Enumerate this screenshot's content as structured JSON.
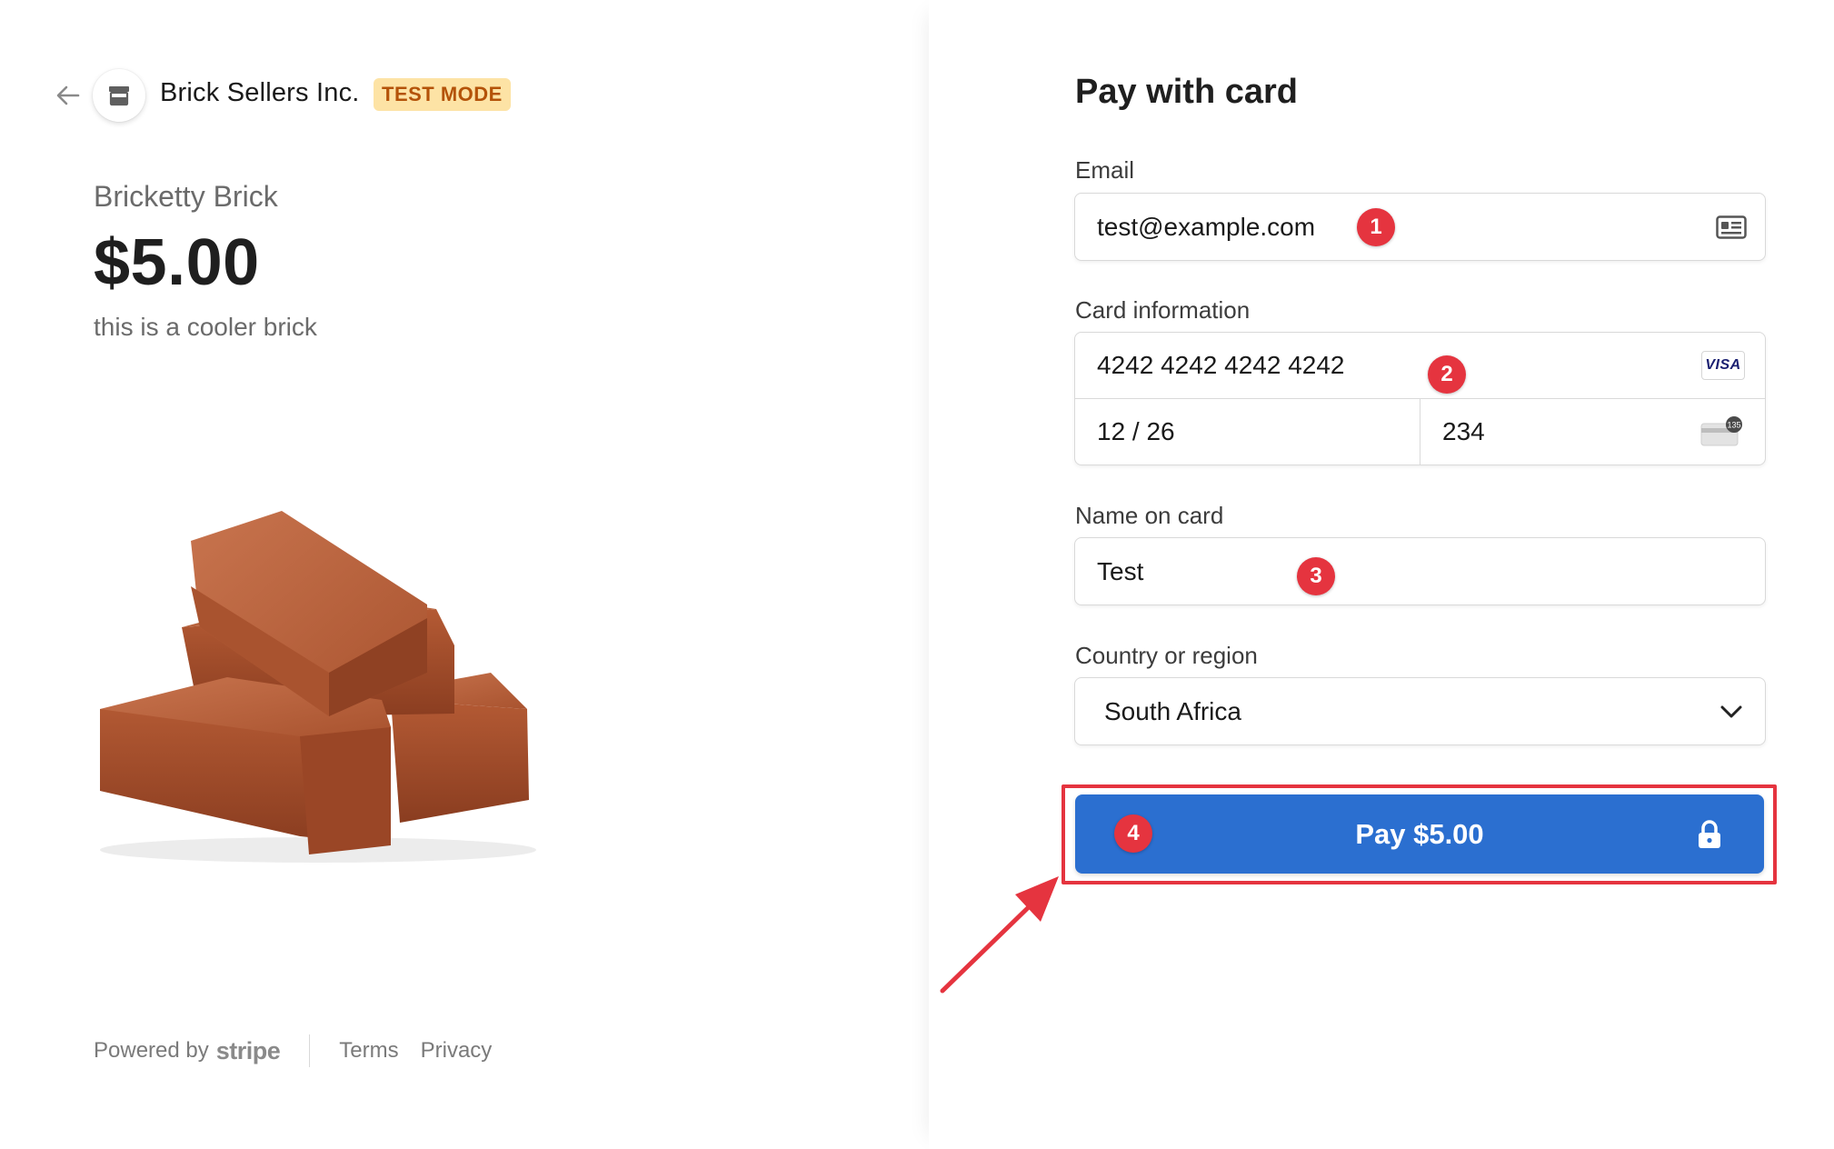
{
  "merchant": {
    "name": "Brick Sellers Inc.",
    "badge": "TEST MODE"
  },
  "product": {
    "name": "Bricketty Brick",
    "price": "$5.00",
    "description": "this is a cooler brick"
  },
  "footer": {
    "powered_by": "Powered by",
    "brand": "stripe",
    "terms": "Terms",
    "privacy": "Privacy"
  },
  "form": {
    "title": "Pay with card",
    "email": {
      "label": "Email",
      "value": "test@example.com"
    },
    "card": {
      "label": "Card information",
      "number": "4242 4242 4242 4242",
      "brand": "VISA",
      "expiry": "12 / 26",
      "cvc": "234",
      "cvc_hint": "135"
    },
    "name": {
      "label": "Name on card",
      "value": "Test"
    },
    "country": {
      "label": "Country or region",
      "value": "South Africa"
    },
    "pay_button": "Pay $5.00"
  },
  "annotations": {
    "steps": [
      "1",
      "2",
      "3",
      "4"
    ],
    "color": "#e5343f"
  },
  "colors": {
    "accent": "#2b6fd0",
    "badge_bg": "#fde3a5",
    "badge_text": "#b45309"
  }
}
